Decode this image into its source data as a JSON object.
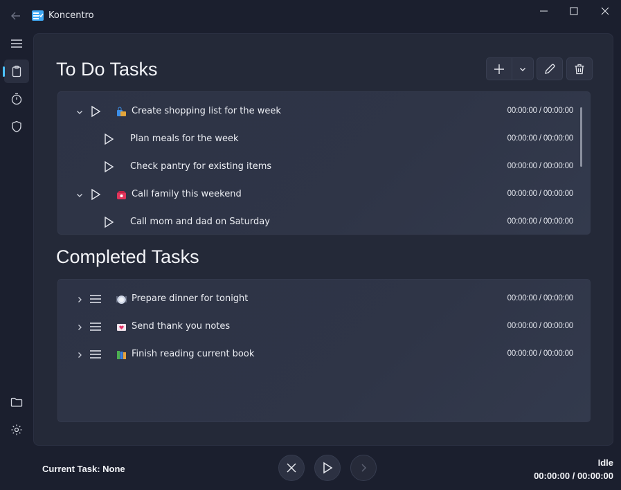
{
  "app": {
    "title": "Koncentro"
  },
  "sidebar": {
    "items": [
      {
        "icon": "menu-icon"
      },
      {
        "icon": "clipboard-icon",
        "active": true
      },
      {
        "icon": "stopwatch-icon"
      },
      {
        "icon": "shield-icon"
      },
      {
        "icon": "folder-icon"
      },
      {
        "icon": "settings-icon"
      }
    ]
  },
  "todo": {
    "title": "To Do Tasks",
    "tasks": [
      {
        "name": "Create shopping list for the week",
        "time": "00:00:00 / 00:00:00",
        "emoji": "shopping-bags-icon",
        "level": 0,
        "expanded": true
      },
      {
        "name": "Plan meals for the week",
        "time": "00:00:00 / 00:00:00",
        "level": 1
      },
      {
        "name": "Check pantry for existing items",
        "time": "00:00:00 / 00:00:00",
        "level": 1
      },
      {
        "name": "Call family this weekend",
        "time": "00:00:00 / 00:00:00",
        "emoji": "telephone-icon",
        "level": 0,
        "expanded": true
      },
      {
        "name": "Call mom and dad on Saturday",
        "time": "00:00:00 / 00:00:00",
        "level": 1
      }
    ]
  },
  "completed": {
    "title": "Completed Tasks",
    "tasks": [
      {
        "name": "Prepare dinner for tonight",
        "time": "00:00:00 / 00:00:00",
        "emoji": "plate-icon"
      },
      {
        "name": "Send thank you notes",
        "time": "00:00:00 / 00:00:00",
        "emoji": "love-letter-icon"
      },
      {
        "name": "Finish reading current book",
        "time": "00:00:00 / 00:00:00",
        "emoji": "books-icon"
      }
    ]
  },
  "footer": {
    "current_task": "Current Task: None",
    "status": "Idle",
    "time": "00:00:00 / 00:00:00"
  },
  "colors": {
    "accent": "#4cc2ff",
    "background": "#1b1f2e",
    "panel": "#242938"
  }
}
